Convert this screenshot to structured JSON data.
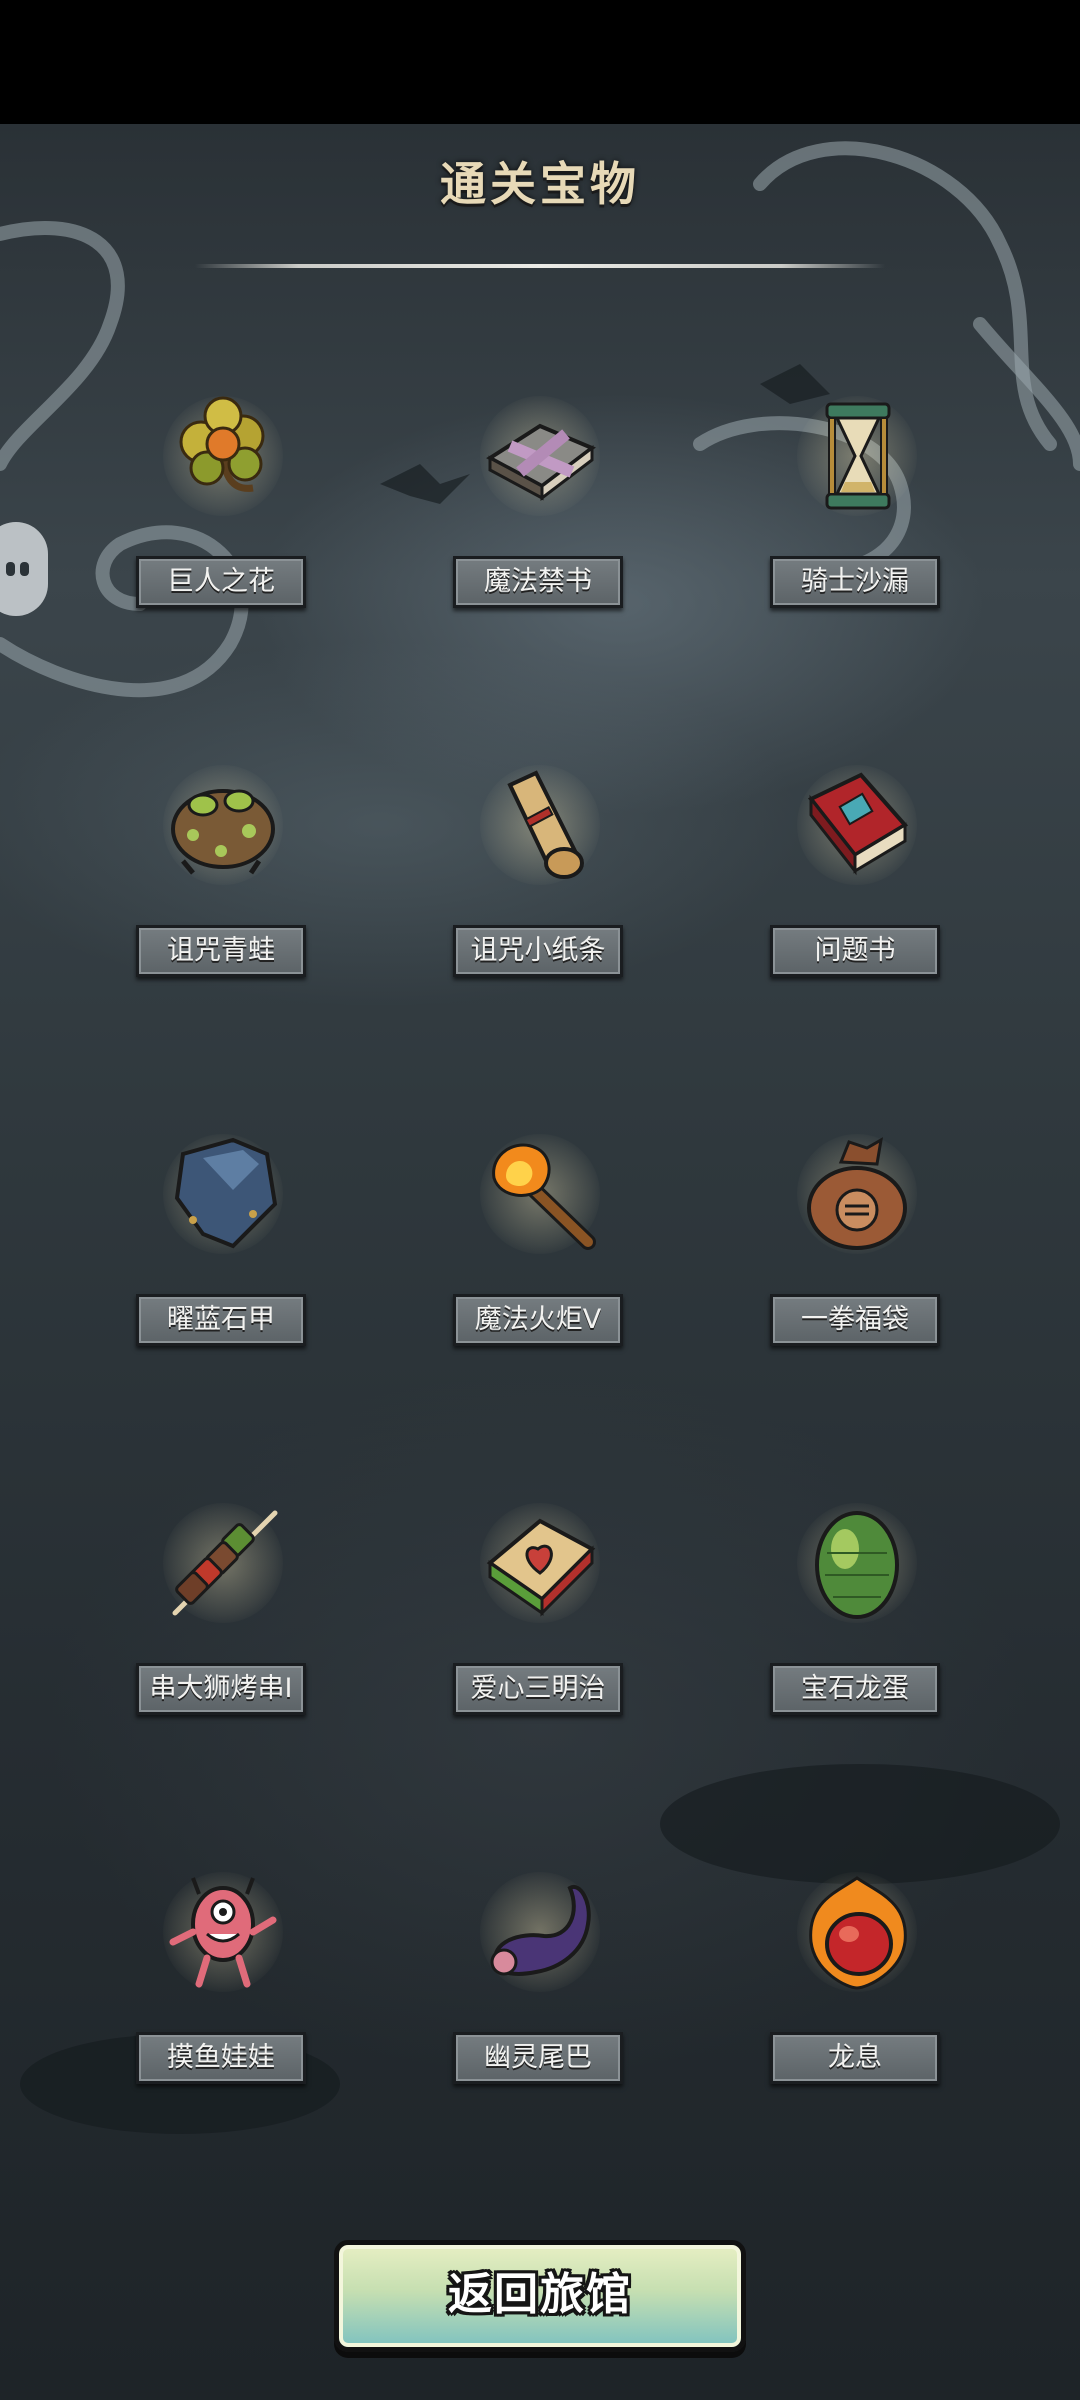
{
  "header": {
    "title": "通关宝物"
  },
  "treasures": [
    {
      "name": "巨人之花",
      "icon": "giant-flower-icon"
    },
    {
      "name": "魔法禁书",
      "icon": "forbidden-book-icon"
    },
    {
      "name": "骑士沙漏",
      "icon": "hourglass-icon"
    },
    {
      "name": "诅咒青蛙",
      "icon": "cursed-frog-icon"
    },
    {
      "name": "诅咒小纸条",
      "icon": "scroll-icon"
    },
    {
      "name": "问题书",
      "icon": "question-book-icon"
    },
    {
      "name": "曜蓝石甲",
      "icon": "blue-armor-icon"
    },
    {
      "name": "魔法火炬V",
      "icon": "torch-icon"
    },
    {
      "name": "一拳福袋",
      "icon": "fist-bag-icon"
    },
    {
      "name": "串大狮烤串I",
      "icon": "kebab-icon"
    },
    {
      "name": "爱心三明治",
      "icon": "sandwich-icon"
    },
    {
      "name": "宝石龙蛋",
      "icon": "dragon-egg-icon"
    },
    {
      "name": "摸鱼娃娃",
      "icon": "pink-doll-icon"
    },
    {
      "name": "幽灵尾巴",
      "icon": "ghost-tail-icon"
    },
    {
      "name": "龙息",
      "icon": "dragon-heart-icon"
    }
  ],
  "footer": {
    "return_label": "返回旅馆"
  },
  "colors": {
    "title": "#e7d9b7",
    "label_bg": "#6b7276",
    "button_top": "#e7efc3",
    "button_bottom": "#7ec2c0"
  }
}
